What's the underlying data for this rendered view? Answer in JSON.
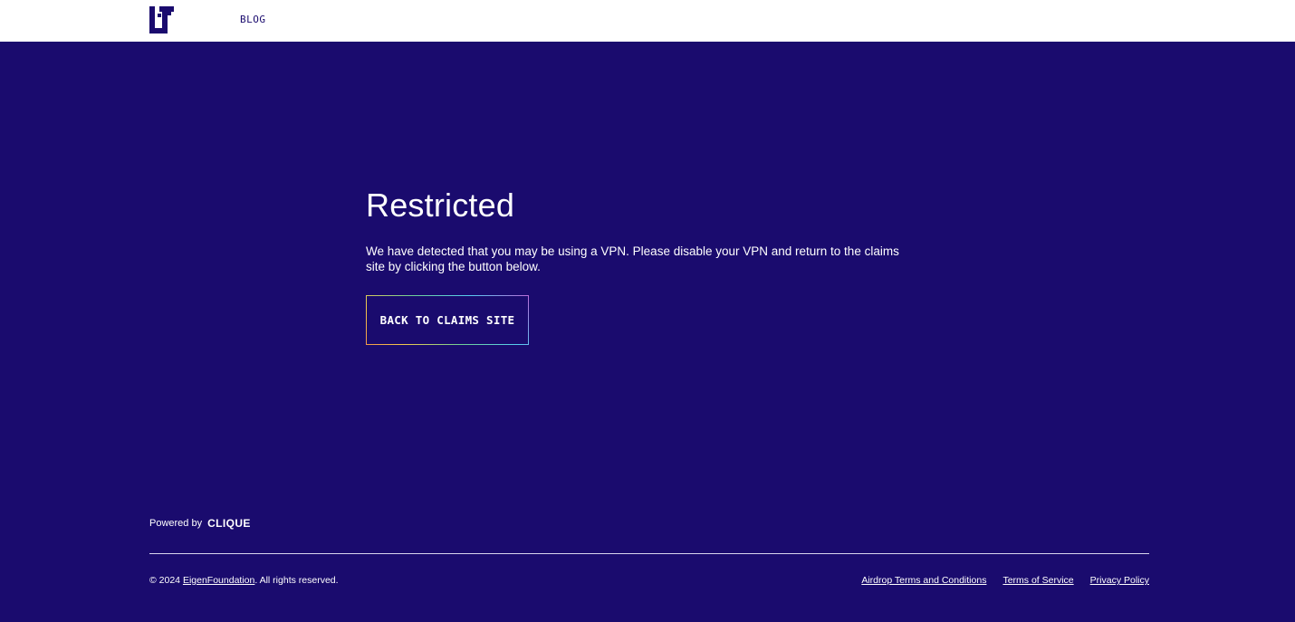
{
  "header": {
    "logo_icon": "eigenlayer-logo-icon",
    "nav_blog_label": "BLOG"
  },
  "main": {
    "title": "Restricted",
    "message": "We have detected that you may be using a VPN.  Please disable your VPN and return to the claims site by clicking the button below.",
    "cta_label": "BACK TO CLAIMS SITE"
  },
  "footer": {
    "powered_by_label": "Powered by",
    "powered_by_brand": "CLIQUE",
    "copyright_prefix": "© 2024",
    "copyright_link": "EigenFoundation",
    "copyright_suffix": ". All rights reserved.",
    "links": [
      {
        "label": "Airdrop Terms and Conditions"
      },
      {
        "label": "Terms of Service"
      },
      {
        "label": "Privacy Policy"
      }
    ]
  },
  "colors": {
    "background": "#1a0b6e",
    "header_background": "#ffffff",
    "text": "#ffffff",
    "button_gradient": [
      "#f2994a",
      "#f2c94c",
      "#6fcf97",
      "#56ccf2",
      "#bb6bd9"
    ]
  }
}
